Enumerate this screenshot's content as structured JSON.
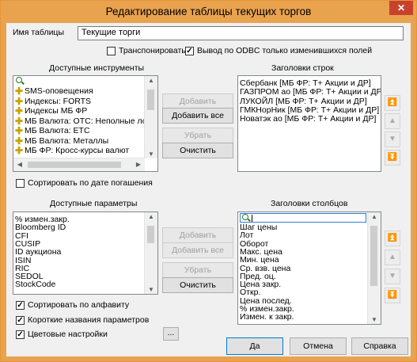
{
  "window": {
    "title": "Редактирование таблицы текущих торгов",
    "close": "✕"
  },
  "table_name": {
    "label": "Имя таблицы",
    "value": "Текущие торги"
  },
  "options": {
    "transpose": {
      "label": "Транспонировать",
      "checked": false
    },
    "odbc": {
      "label": "Вывод по ODBC только изменившихся  полей",
      "checked": true
    }
  },
  "instruments": {
    "label": "Доступные инструменты",
    "items": [
      "SMS-оповещения",
      "Индексы: FORTS",
      "Индексы МБ ФР",
      "МБ Валюта: OTC: Неполные лоты",
      "МБ Валюта: ETC",
      "МБ Валюта: Металлы",
      "МБ ФР: Кросс-курсы валют"
    ]
  },
  "row_headers": {
    "label": "Заголовки строк",
    "items": [
      "Сбербанк [МБ ФР: Т+ Акции и ДР]",
      "ГАЗПРОМ ао [МБ ФР: Т+ Акции и ДР]",
      "ЛУКОЙЛ [МБ ФР: Т+ Акции и ДР]",
      "ГМКНорНик [МБ ФР: Т+ Акции и ДР]",
      "Новатэк ао [МБ ФР: Т+ Акции и ДР]"
    ]
  },
  "buttons1": {
    "add": "Добавить",
    "add_all": "Добавить все",
    "remove": "Убрать",
    "clear": "Очистить"
  },
  "sort_by_date": {
    "label": "Сортировать по дате погашения",
    "checked": false
  },
  "parameters": {
    "label": "Доступные параметры",
    "items": [
      "% измен.закр.",
      "Bloomberg ID",
      "CFI",
      "CUSIP",
      "ID аукциона",
      "ISIN",
      "RIC",
      "SEDOL",
      "StockCode"
    ]
  },
  "col_headers": {
    "label": "Заголовки столбцов",
    "items": [
      "Шаг цены",
      "Лот",
      "Оборот",
      "Макс. цена",
      "Мин. цена",
      "Ср. взв. цена",
      "Пред. оц.",
      "Цена закр.",
      "Откр.",
      "Цена послед.",
      "% измен.закр.",
      "Измен. к закр."
    ]
  },
  "buttons2": {
    "add": "Добавить",
    "add_all": "Добавить все",
    "remove": "Убрать",
    "clear": "Очистить"
  },
  "bottom": {
    "sort_alpha": {
      "label": "Сортировать по алфавиту",
      "checked": true
    },
    "short_names": {
      "label": "Короткие названия параметров",
      "checked": true
    },
    "color_settings": {
      "label": "Цветовые настройки",
      "checked": true
    },
    "ellipsis": "..."
  },
  "dialog": {
    "ok": "Да",
    "cancel": "Отмена",
    "help": "Справка"
  },
  "icons": {
    "move_top": "⏫",
    "move_up": "▲",
    "move_down": "▼",
    "move_bottom": "⏬",
    "check": "✓"
  },
  "colors": {
    "titlebar": "#e9a24e",
    "close": "#c7422d",
    "plus": "#c8a200",
    "focus": "#0078d7"
  }
}
